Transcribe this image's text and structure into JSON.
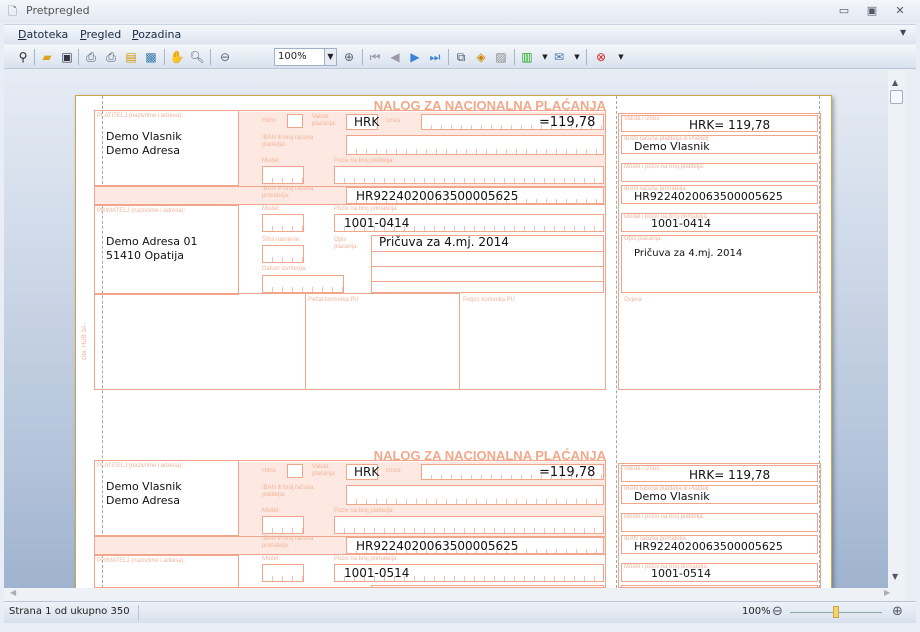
{
  "window": {
    "title": "Pretpregled",
    "minimize": "▭",
    "restore": "▣",
    "close": "✕"
  },
  "menu": [
    {
      "label": "Datoteka",
      "u": "D",
      "rest": "atoteka"
    },
    {
      "label": "Pregled",
      "u": "P",
      "rest": "regled"
    },
    {
      "label": "Pozadina",
      "u": "P",
      "rest": "ozadina"
    }
  ],
  "toolbar": {
    "zoom_value": "100%"
  },
  "form_labels": {
    "title": "NALOG ZA NACIONALNA PLAĆANJA",
    "platitelj": "PLATITELJ (naziv/ime i adresa):",
    "primatelj": "PRIMATELJ (naziv/ime i adresa):",
    "hitno": "Hitno",
    "valuta": "Valuta plaćanja:",
    "iznos": "Iznos:",
    "iban_platitelja": "IBAN ili broj računa platitelja:",
    "model": "Model:",
    "poziv_platitelja": "Poziv na broj platitelja:",
    "iban_primatelja": "IBAN ili broj računa primatelja:",
    "poziv_primatelja": "Poziv na broj primatelja:",
    "sifra": "Šifra namjene:",
    "opis": "Opis plaćanja:",
    "datum": "Datum izvršenja:",
    "pecat": "Pečat korisnika PU",
    "potpis": "Potpis korisnika PU",
    "obr": "Obr. HUB 3A -",
    "r_valuta": "Valuta i iznos:",
    "r_iban_plat": "IBAN računa platitelja ili Platitelj",
    "r_model_plat": "Model i poziv na broj platitelja:",
    "r_iban_prim": "IBAN računa primatelja",
    "r_model_prim": "Model i poziv na broj primatelja:",
    "r_opis": "Opis plaćanja:",
    "r_ovjera": "Ovjera"
  },
  "forms": [
    {
      "payer_name": "Demo Vlasnik",
      "payer_address": "Demo Adresa",
      "currency": "HRK",
      "amount": "=119,78",
      "recipient_iban": "HR9224020063500005625",
      "reference": "1001-0414",
      "recipient_address1": "Demo Adresa 01",
      "recipient_address2": "51410 Opatija",
      "description": "Pričuva za 4.mj. 2014",
      "r_amount": "HRK= 119,78"
    },
    {
      "payer_name": "Demo Vlasnik",
      "payer_address": "Demo Adresa",
      "currency": "HRK",
      "amount": "=119,78",
      "recipient_iban": "HR9224020063500005625",
      "reference": "1001-0514",
      "recipient_address1": "",
      "recipient_address2": "",
      "description": "",
      "r_amount": "HRK= 119,78"
    }
  ],
  "status": {
    "page_text": "Strana 1 od ukupno 350",
    "zoom": "100%",
    "zoom_level_percent": 50
  }
}
